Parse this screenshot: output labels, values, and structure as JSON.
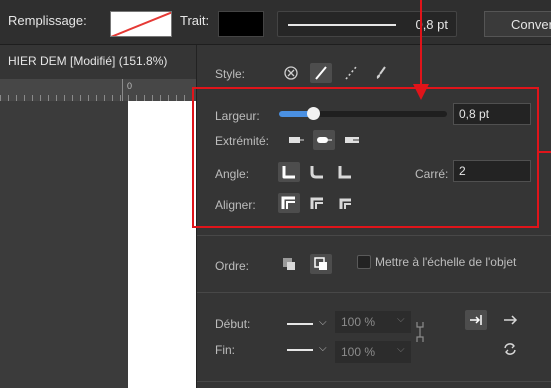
{
  "toolbar": {
    "fill_label": "Remplissage:",
    "stroke_label": "Trait:",
    "stroke_width": "0,8 pt",
    "convert_label": "Converti"
  },
  "document": {
    "tab_title": "HIER DEM [Modifié] (151.8%)",
    "ruler_zero": "0"
  },
  "panel": {
    "style_label": "Style:",
    "width_label": "Largeur:",
    "width_value": "0,8 pt",
    "width_fraction": 0.2,
    "cap_label": "Extrémité:",
    "join_label": "Angle:",
    "miter_label": "Carré:",
    "miter_value": "2",
    "align_label": "Aligner:",
    "order_label": "Ordre:",
    "scale_label": "Mettre à l'échelle de l'objet",
    "start_label": "Début:",
    "end_label": "Fin:",
    "start_percent": "100 %",
    "end_percent": "100 %"
  },
  "colors": {
    "highlight": "#e0141a",
    "accent": "#4a90e2",
    "panel_bg": "#353535"
  }
}
